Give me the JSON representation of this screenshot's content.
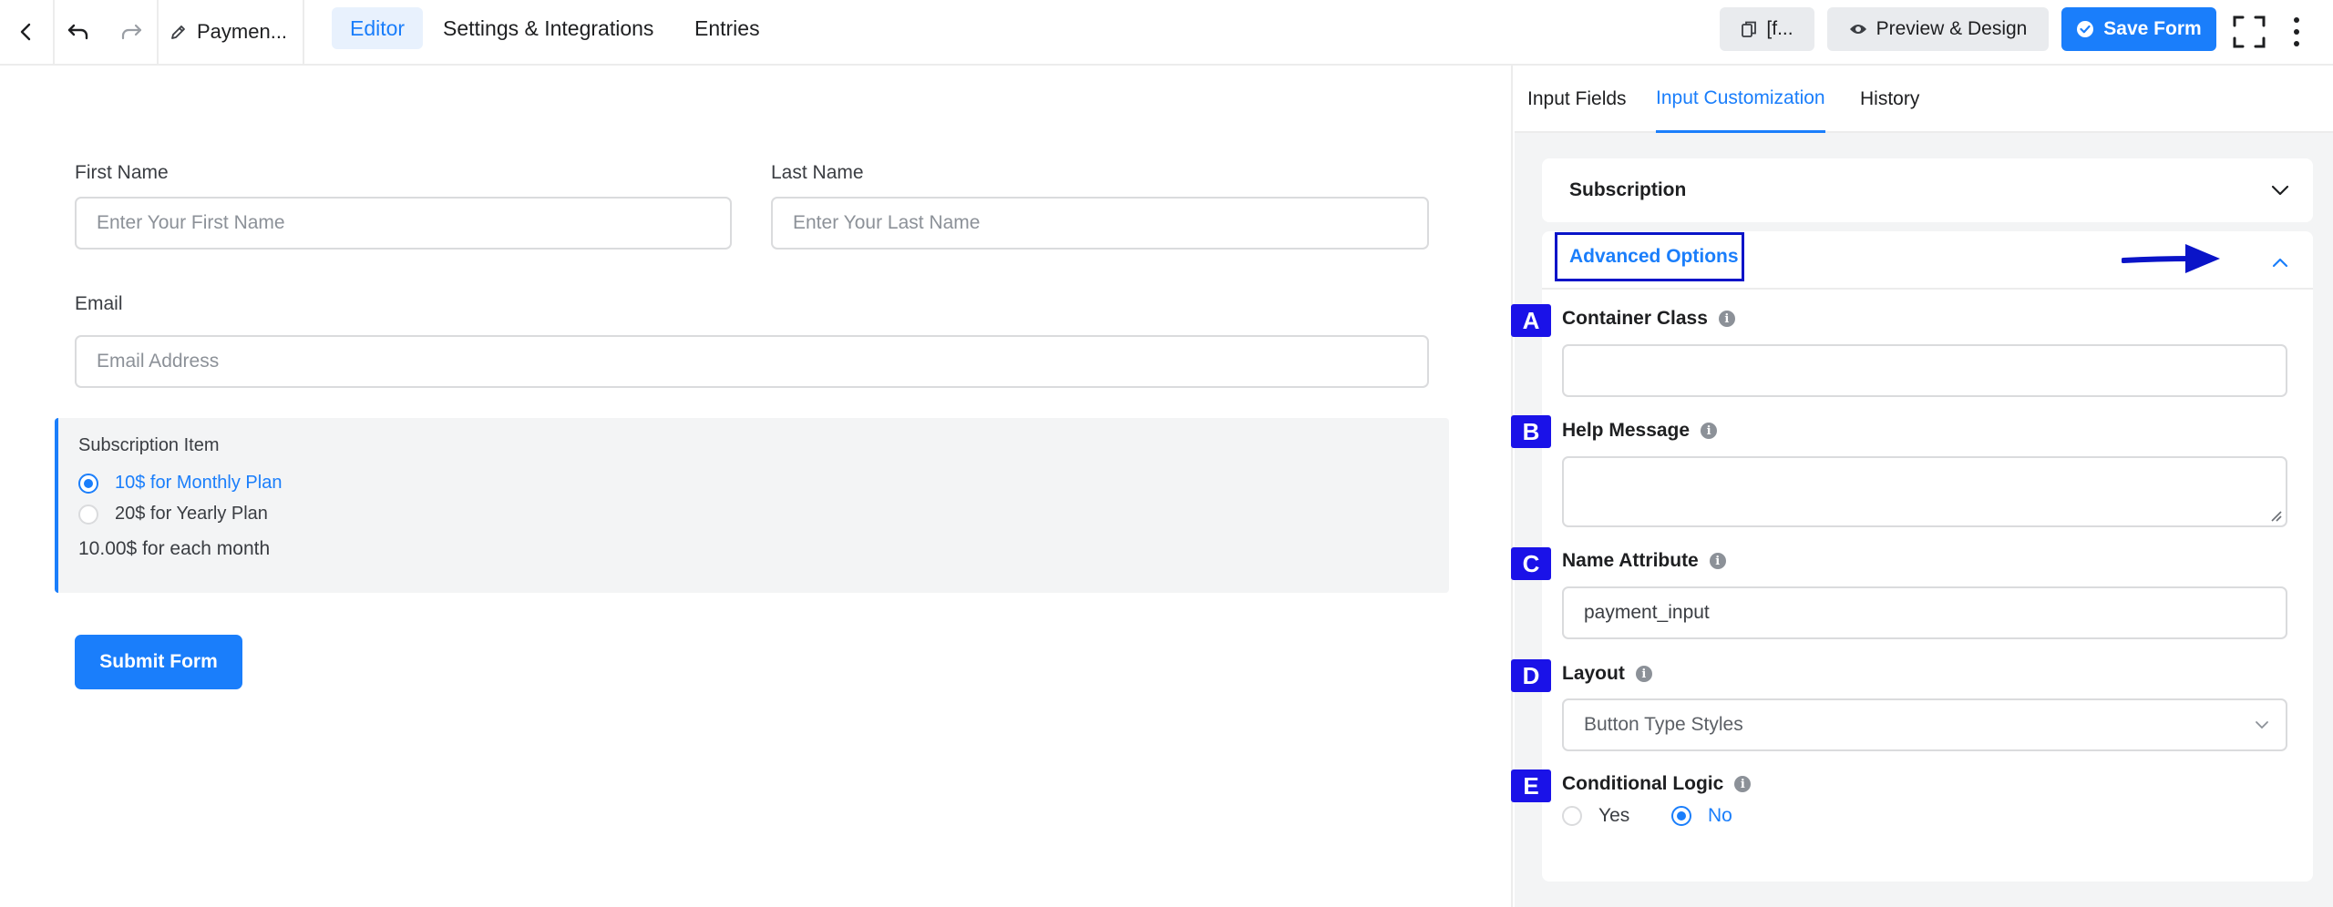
{
  "topbar": {
    "form_title": "Paymen...",
    "tabs": [
      {
        "label": "Editor"
      },
      {
        "label": "Settings & Integrations"
      },
      {
        "label": "Entries"
      }
    ],
    "shortcode_label": "[f...",
    "preview_label": "Preview & Design",
    "save_label": "Save Form"
  },
  "form": {
    "first_name": {
      "label": "First Name",
      "placeholder": "Enter Your First Name"
    },
    "last_name": {
      "label": "Last Name",
      "placeholder": "Enter Your Last Name"
    },
    "email": {
      "label": "Email",
      "placeholder": "Email Address"
    },
    "subscription": {
      "title": "Subscription Item",
      "options": [
        {
          "label": "10$ for Monthly Plan",
          "selected": true
        },
        {
          "label": "20$ for Yearly Plan",
          "selected": false
        }
      ],
      "price_text": "10.00$ for each month"
    },
    "submit_label": "Submit Form"
  },
  "panel": {
    "tabs": [
      {
        "label": "Input Fields"
      },
      {
        "label": "Input Customization"
      },
      {
        "label": "History"
      }
    ],
    "subscription_section": "Subscription",
    "advanced_section": "Advanced Options",
    "options": {
      "container_class": {
        "badge": "A",
        "label": "Container Class",
        "value": ""
      },
      "help_message": {
        "badge": "B",
        "label": "Help Message",
        "value": ""
      },
      "name_attribute": {
        "badge": "C",
        "label": "Name Attribute",
        "value": "payment_input"
      },
      "layout": {
        "badge": "D",
        "label": "Layout",
        "value": "Button Type Styles"
      },
      "conditional_logic": {
        "badge": "E",
        "label": "Conditional Logic",
        "yes": "Yes",
        "no": "No",
        "selected": "No"
      }
    }
  },
  "colors": {
    "accent": "#1a7efb",
    "badge": "#1a12e8",
    "annotation_outline": "#0a14c8"
  }
}
